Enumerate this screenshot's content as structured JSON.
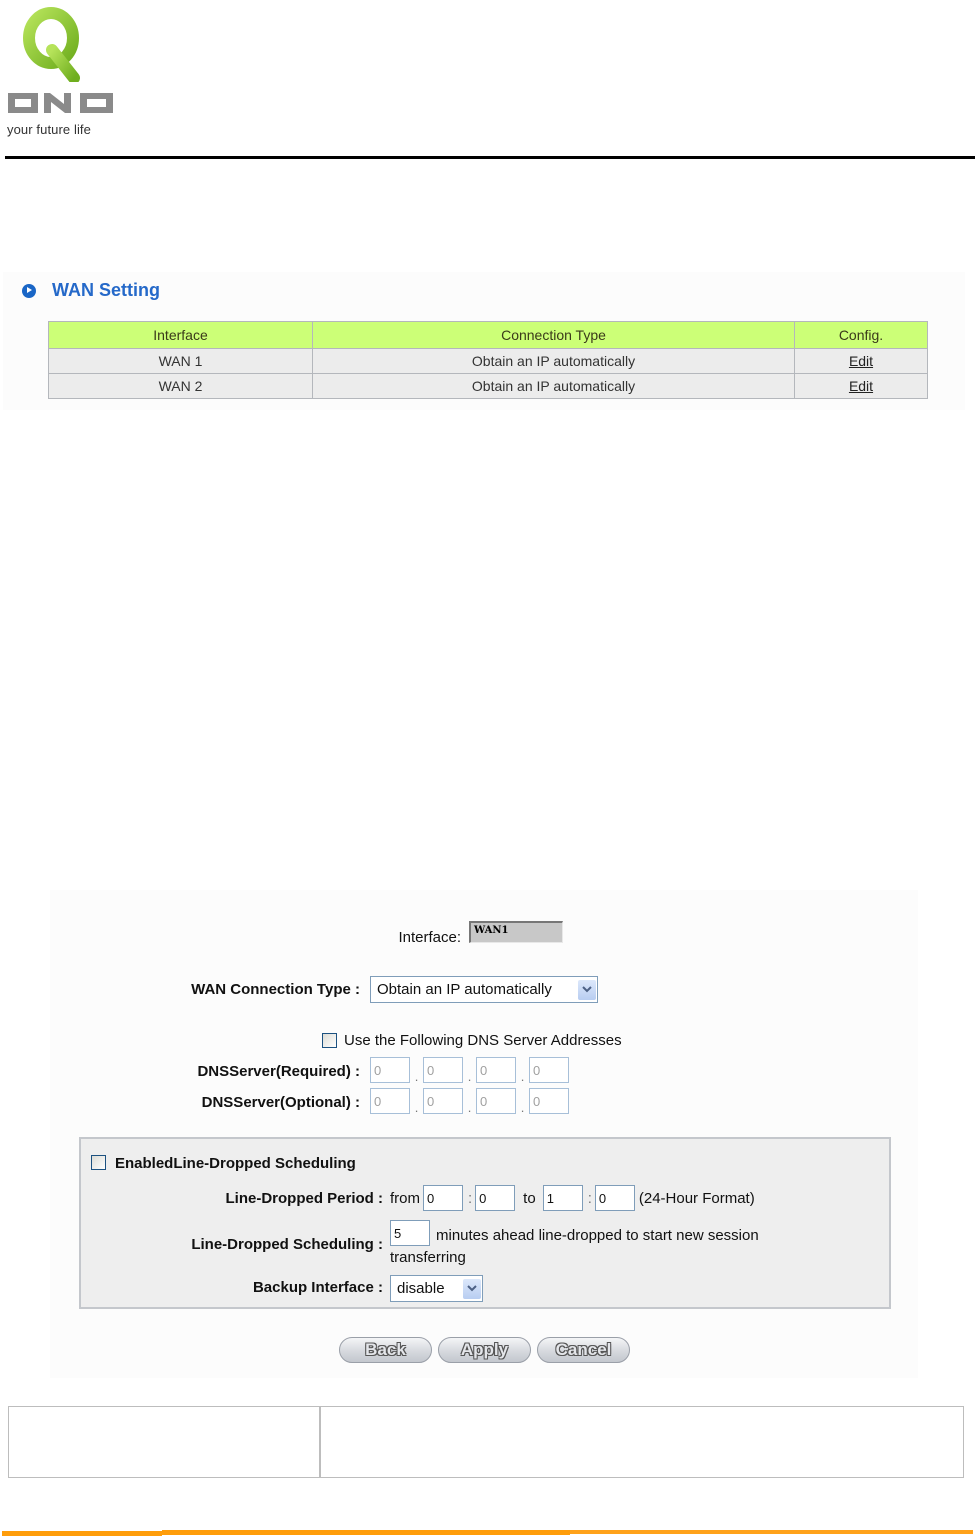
{
  "brand": {
    "name": "QNO",
    "tagline": "your future life",
    "logo_green": "#8cc63f",
    "logo_gray": "#8a8a8a"
  },
  "wan_setting": {
    "title": "WAN Setting",
    "columns": [
      "Interface",
      "Connection Type",
      "Config."
    ],
    "rows": [
      {
        "interface": "WAN 1",
        "connection_type": "Obtain an IP automatically",
        "action": "Edit"
      },
      {
        "interface": "WAN 2",
        "connection_type": "Obtain an IP automatically",
        "action": "Edit"
      }
    ],
    "header_color": "#ccff77",
    "title_color": "#2569c9"
  },
  "form": {
    "interface_label": "Interface:",
    "interface_value": "WAN1",
    "connection_type_label": "WAN  Connection Type :",
    "connection_type_value": "Obtain an IP automatically",
    "dns_checkbox_label": "Use the Following DNS Server Addresses",
    "dns_checkbox_checked": false,
    "dns_required_label": "DNSServer(Required) :",
    "dns_required": [
      "0",
      "0",
      "0",
      "0"
    ],
    "dns_optional_label": "DNSServer(Optional) :",
    "dns_optional": [
      "0",
      "0",
      "0",
      "0"
    ],
    "schedule": {
      "enable_label": "EnabledLine-Dropped Scheduling",
      "enabled": false,
      "period_label": "Line-Dropped Period :",
      "from_label": "from",
      "to_label": "to",
      "colon": ":",
      "from_hour": "0",
      "from_minute": "0",
      "to_hour": "1",
      "to_minute": "0",
      "format_note": "(24-Hour Format)",
      "scheduling_label": "Line-Dropped Scheduling :",
      "minutes_value": "5",
      "minutes_text": "minutes ahead line-dropped to start new session",
      "minutes_text_cont": "transferring",
      "backup_label": "Backup Interface :",
      "backup_value": "disable"
    },
    "buttons": {
      "back": "Back",
      "apply": "Apply",
      "cancel": "Cancel"
    }
  },
  "footer": {
    "accent_color": "#ff9d0a"
  }
}
